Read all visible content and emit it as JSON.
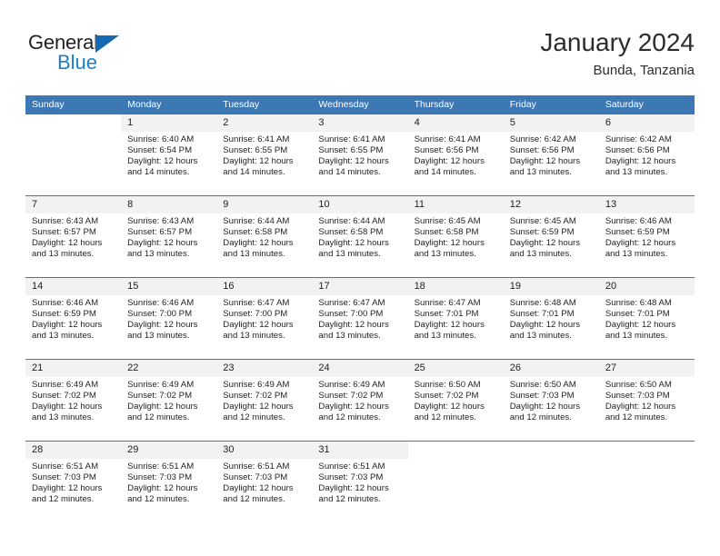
{
  "brand": {
    "name_part1": "General",
    "name_part2": "Blue"
  },
  "header": {
    "title": "January 2024",
    "subtitle": "Bunda, Tanzania"
  },
  "weekday_headers": [
    "Sunday",
    "Monday",
    "Tuesday",
    "Wednesday",
    "Thursday",
    "Friday",
    "Saturday"
  ],
  "colors": {
    "header_blue": "#3c78b4",
    "logo_blue": "#1d7ec8",
    "daynum_bg": "#f2f2f2",
    "text": "#231f20"
  },
  "weeks": [
    [
      {
        "day": "",
        "sunrise": "",
        "sunset": "",
        "daylight1": "",
        "daylight2": "",
        "empty": true
      },
      {
        "day": "1",
        "sunrise": "Sunrise: 6:40 AM",
        "sunset": "Sunset: 6:54 PM",
        "daylight1": "Daylight: 12 hours",
        "daylight2": "and 14 minutes.",
        "empty": false
      },
      {
        "day": "2",
        "sunrise": "Sunrise: 6:41 AM",
        "sunset": "Sunset: 6:55 PM",
        "daylight1": "Daylight: 12 hours",
        "daylight2": "and 14 minutes.",
        "empty": false
      },
      {
        "day": "3",
        "sunrise": "Sunrise: 6:41 AM",
        "sunset": "Sunset: 6:55 PM",
        "daylight1": "Daylight: 12 hours",
        "daylight2": "and 14 minutes.",
        "empty": false
      },
      {
        "day": "4",
        "sunrise": "Sunrise: 6:41 AM",
        "sunset": "Sunset: 6:56 PM",
        "daylight1": "Daylight: 12 hours",
        "daylight2": "and 14 minutes.",
        "empty": false
      },
      {
        "day": "5",
        "sunrise": "Sunrise: 6:42 AM",
        "sunset": "Sunset: 6:56 PM",
        "daylight1": "Daylight: 12 hours",
        "daylight2": "and 13 minutes.",
        "empty": false
      },
      {
        "day": "6",
        "sunrise": "Sunrise: 6:42 AM",
        "sunset": "Sunset: 6:56 PM",
        "daylight1": "Daylight: 12 hours",
        "daylight2": "and 13 minutes.",
        "empty": false
      }
    ],
    [
      {
        "day": "7",
        "sunrise": "Sunrise: 6:43 AM",
        "sunset": "Sunset: 6:57 PM",
        "daylight1": "Daylight: 12 hours",
        "daylight2": "and 13 minutes.",
        "empty": false
      },
      {
        "day": "8",
        "sunrise": "Sunrise: 6:43 AM",
        "sunset": "Sunset: 6:57 PM",
        "daylight1": "Daylight: 12 hours",
        "daylight2": "and 13 minutes.",
        "empty": false
      },
      {
        "day": "9",
        "sunrise": "Sunrise: 6:44 AM",
        "sunset": "Sunset: 6:58 PM",
        "daylight1": "Daylight: 12 hours",
        "daylight2": "and 13 minutes.",
        "empty": false
      },
      {
        "day": "10",
        "sunrise": "Sunrise: 6:44 AM",
        "sunset": "Sunset: 6:58 PM",
        "daylight1": "Daylight: 12 hours",
        "daylight2": "and 13 minutes.",
        "empty": false
      },
      {
        "day": "11",
        "sunrise": "Sunrise: 6:45 AM",
        "sunset": "Sunset: 6:58 PM",
        "daylight1": "Daylight: 12 hours",
        "daylight2": "and 13 minutes.",
        "empty": false
      },
      {
        "day": "12",
        "sunrise": "Sunrise: 6:45 AM",
        "sunset": "Sunset: 6:59 PM",
        "daylight1": "Daylight: 12 hours",
        "daylight2": "and 13 minutes.",
        "empty": false
      },
      {
        "day": "13",
        "sunrise": "Sunrise: 6:46 AM",
        "sunset": "Sunset: 6:59 PM",
        "daylight1": "Daylight: 12 hours",
        "daylight2": "and 13 minutes.",
        "empty": false
      }
    ],
    [
      {
        "day": "14",
        "sunrise": "Sunrise: 6:46 AM",
        "sunset": "Sunset: 6:59 PM",
        "daylight1": "Daylight: 12 hours",
        "daylight2": "and 13 minutes.",
        "empty": false
      },
      {
        "day": "15",
        "sunrise": "Sunrise: 6:46 AM",
        "sunset": "Sunset: 7:00 PM",
        "daylight1": "Daylight: 12 hours",
        "daylight2": "and 13 minutes.",
        "empty": false
      },
      {
        "day": "16",
        "sunrise": "Sunrise: 6:47 AM",
        "sunset": "Sunset: 7:00 PM",
        "daylight1": "Daylight: 12 hours",
        "daylight2": "and 13 minutes.",
        "empty": false
      },
      {
        "day": "17",
        "sunrise": "Sunrise: 6:47 AM",
        "sunset": "Sunset: 7:00 PM",
        "daylight1": "Daylight: 12 hours",
        "daylight2": "and 13 minutes.",
        "empty": false
      },
      {
        "day": "18",
        "sunrise": "Sunrise: 6:47 AM",
        "sunset": "Sunset: 7:01 PM",
        "daylight1": "Daylight: 12 hours",
        "daylight2": "and 13 minutes.",
        "empty": false
      },
      {
        "day": "19",
        "sunrise": "Sunrise: 6:48 AM",
        "sunset": "Sunset: 7:01 PM",
        "daylight1": "Daylight: 12 hours",
        "daylight2": "and 13 minutes.",
        "empty": false
      },
      {
        "day": "20",
        "sunrise": "Sunrise: 6:48 AM",
        "sunset": "Sunset: 7:01 PM",
        "daylight1": "Daylight: 12 hours",
        "daylight2": "and 13 minutes.",
        "empty": false
      }
    ],
    [
      {
        "day": "21",
        "sunrise": "Sunrise: 6:49 AM",
        "sunset": "Sunset: 7:02 PM",
        "daylight1": "Daylight: 12 hours",
        "daylight2": "and 13 minutes.",
        "empty": false
      },
      {
        "day": "22",
        "sunrise": "Sunrise: 6:49 AM",
        "sunset": "Sunset: 7:02 PM",
        "daylight1": "Daylight: 12 hours",
        "daylight2": "and 12 minutes.",
        "empty": false
      },
      {
        "day": "23",
        "sunrise": "Sunrise: 6:49 AM",
        "sunset": "Sunset: 7:02 PM",
        "daylight1": "Daylight: 12 hours",
        "daylight2": "and 12 minutes.",
        "empty": false
      },
      {
        "day": "24",
        "sunrise": "Sunrise: 6:49 AM",
        "sunset": "Sunset: 7:02 PM",
        "daylight1": "Daylight: 12 hours",
        "daylight2": "and 12 minutes.",
        "empty": false
      },
      {
        "day": "25",
        "sunrise": "Sunrise: 6:50 AM",
        "sunset": "Sunset: 7:02 PM",
        "daylight1": "Daylight: 12 hours",
        "daylight2": "and 12 minutes.",
        "empty": false
      },
      {
        "day": "26",
        "sunrise": "Sunrise: 6:50 AM",
        "sunset": "Sunset: 7:03 PM",
        "daylight1": "Daylight: 12 hours",
        "daylight2": "and 12 minutes.",
        "empty": false
      },
      {
        "day": "27",
        "sunrise": "Sunrise: 6:50 AM",
        "sunset": "Sunset: 7:03 PM",
        "daylight1": "Daylight: 12 hours",
        "daylight2": "and 12 minutes.",
        "empty": false
      }
    ],
    [
      {
        "day": "28",
        "sunrise": "Sunrise: 6:51 AM",
        "sunset": "Sunset: 7:03 PM",
        "daylight1": "Daylight: 12 hours",
        "daylight2": "and 12 minutes.",
        "empty": false
      },
      {
        "day": "29",
        "sunrise": "Sunrise: 6:51 AM",
        "sunset": "Sunset: 7:03 PM",
        "daylight1": "Daylight: 12 hours",
        "daylight2": "and 12 minutes.",
        "empty": false
      },
      {
        "day": "30",
        "sunrise": "Sunrise: 6:51 AM",
        "sunset": "Sunset: 7:03 PM",
        "daylight1": "Daylight: 12 hours",
        "daylight2": "and 12 minutes.",
        "empty": false
      },
      {
        "day": "31",
        "sunrise": "Sunrise: 6:51 AM",
        "sunset": "Sunset: 7:03 PM",
        "daylight1": "Daylight: 12 hours",
        "daylight2": "and 12 minutes.",
        "empty": false
      },
      {
        "day": "",
        "sunrise": "",
        "sunset": "",
        "daylight1": "",
        "daylight2": "",
        "empty": true
      },
      {
        "day": "",
        "sunrise": "",
        "sunset": "",
        "daylight1": "",
        "daylight2": "",
        "empty": true
      },
      {
        "day": "",
        "sunrise": "",
        "sunset": "",
        "daylight1": "",
        "daylight2": "",
        "empty": true
      }
    ]
  ]
}
